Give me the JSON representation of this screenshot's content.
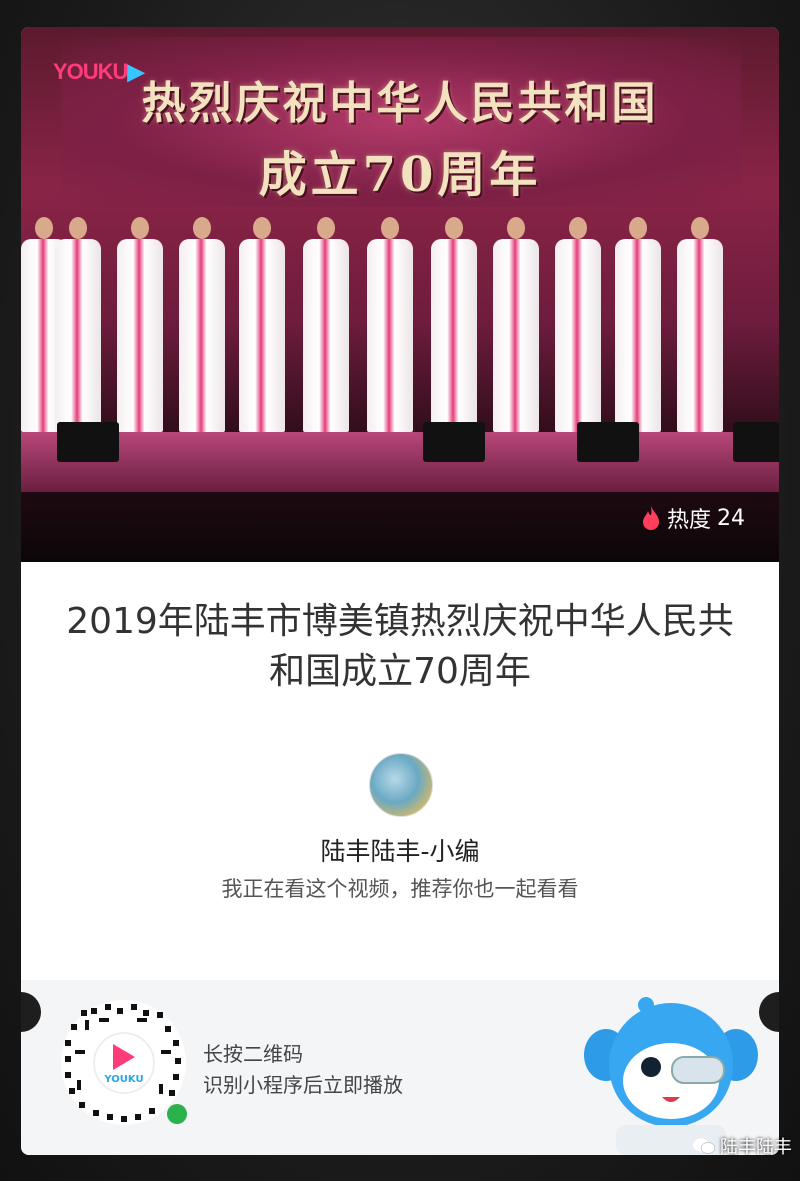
{
  "video": {
    "logo_text": "YOUKU",
    "banner_line1": "热烈庆祝中华人民共和国",
    "banner_line2": "成立70周年",
    "heat_label": "热度",
    "heat_value": "24",
    "brand_color": "#ff3c7a",
    "accent_color": "#37c6ff"
  },
  "title": "2019年陆丰市博美镇热烈庆祝中华人民共和国成立70周年",
  "author": {
    "name": "陆丰陆丰-小编",
    "recommend_text": "我正在看这个视频，推荐你也一起看看",
    "avatar_icon": "avatar-image"
  },
  "bottom": {
    "qr_brand": "YOUKU",
    "hint_line1": "长按二维码",
    "hint_line2": "识别小程序后立即播放",
    "mascot_icon": "youku-mascot"
  },
  "watermark": "陆丰陆丰"
}
